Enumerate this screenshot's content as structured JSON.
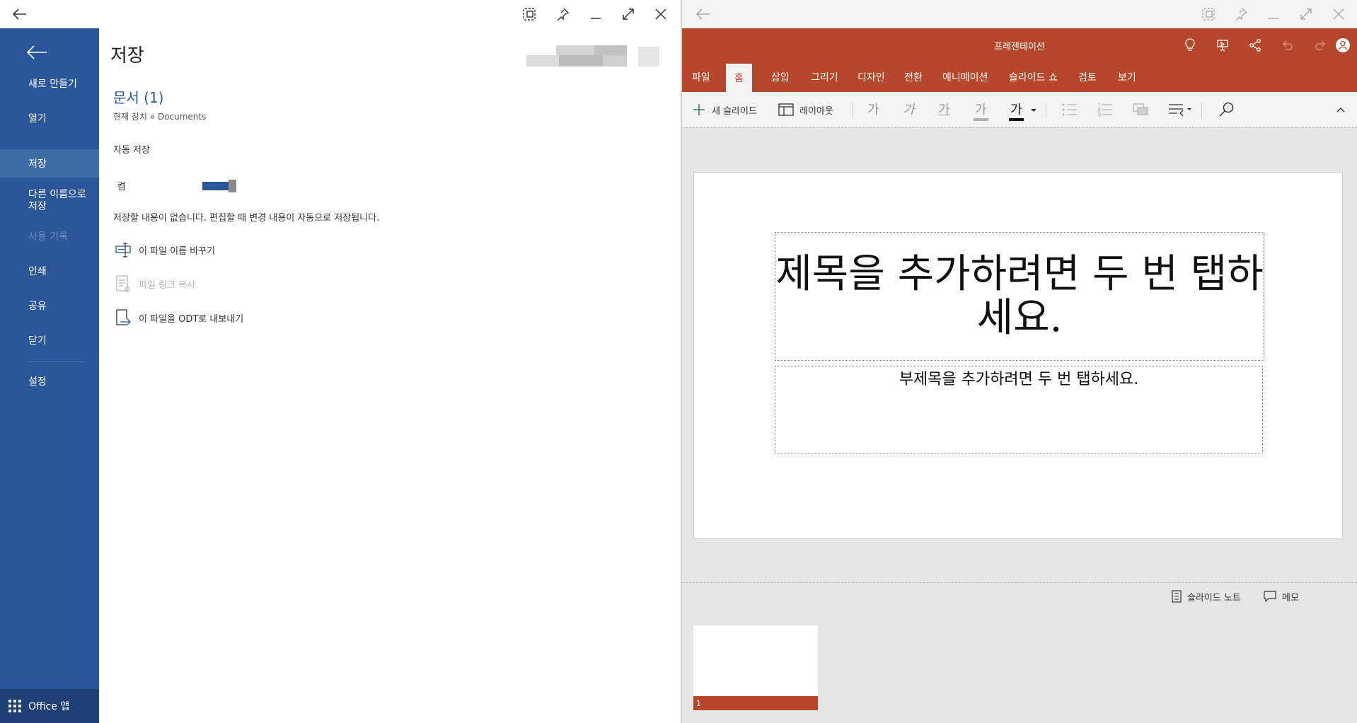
{
  "left_window": {
    "sidebar": {
      "items": [
        {
          "label": "새로 만들기"
        },
        {
          "label": "열기"
        },
        {
          "label": "저장"
        },
        {
          "label": "다른 이름으로\n저장"
        },
        {
          "label": "사용 기록"
        },
        {
          "label": "인쇄"
        },
        {
          "label": "공유"
        },
        {
          "label": "닫기"
        },
        {
          "label": "설정"
        }
      ],
      "active_item": "저장",
      "bottom_label": "Office 앱"
    },
    "page_title": "저장",
    "document": {
      "name": "문서 (1)",
      "path": "현재 장치 » Documents"
    },
    "autosave": {
      "label": "자동 저장",
      "state_label": "켬",
      "on": true
    },
    "message": "저장할 내용이 없습니다. 편집할 때 변경 내용이 자동으로 저장됩니다.",
    "actions": [
      {
        "label": "이 파일 이름 바꾸기",
        "enabled": true
      },
      {
        "label": "파일 링크 복사",
        "enabled": false
      },
      {
        "label": "이 파일을 ODT로 내보내기",
        "enabled": true
      }
    ]
  },
  "right_window": {
    "app_title": "프레젠테이션",
    "ribbon_tabs": [
      "파일",
      "홈",
      "삽입",
      "그리기",
      "디자인",
      "전환",
      "애니메이션",
      "슬라이드 쇼",
      "검토",
      "보기"
    ],
    "active_tab": "홈",
    "toolbar": {
      "new_slide": "새 슬라이드",
      "layout": "레이아웃",
      "bold": "가",
      "italic": "가",
      "underline": "가",
      "highlight": "가",
      "font_color": "가"
    },
    "slide": {
      "title_placeholder": "제목을 추가하려면 두 번 탭하세요.",
      "subtitle_placeholder": "부제목을 추가하려면 두 번 탭하세요."
    },
    "status": {
      "notes": "슬라이드 노트",
      "comments": "메모"
    },
    "thumbnails": [
      {
        "number": "1"
      }
    ]
  },
  "colors": {
    "word_blue": "#2b579a",
    "ppt_orange": "#b7472a"
  }
}
